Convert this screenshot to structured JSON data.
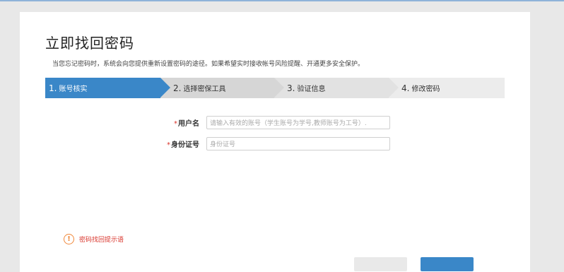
{
  "page": {
    "title": "立即找回密码",
    "description": "当您忘记密码时，系统会向您提供重新设置密码的途径。如果希望实时接收帐号风险提醒、开通更多安全保护。"
  },
  "steps": [
    {
      "num": "1.",
      "label": "账号核实",
      "active": true
    },
    {
      "num": "2.",
      "label": "选择密保工具",
      "active": false
    },
    {
      "num": "3.",
      "label": "验证信息",
      "active": false
    },
    {
      "num": "4.",
      "label": "修改密码",
      "active": false
    }
  ],
  "form": {
    "username": {
      "required_mark": "*",
      "label": "用户名",
      "placeholder": "请输入有效的账号（学生账号为学号,教师账号为工号）.",
      "value": ""
    },
    "id_number": {
      "required_mark": "*",
      "label": "身份证号",
      "placeholder": "身份证号",
      "value": ""
    }
  },
  "hint": {
    "icon": "exclamation-circle-icon",
    "text": "密码找回提示语",
    "color": "#d9342b"
  },
  "colors": {
    "accent": "#3a87c8",
    "required": "#d9342b",
    "warning": "#f0883a"
  }
}
